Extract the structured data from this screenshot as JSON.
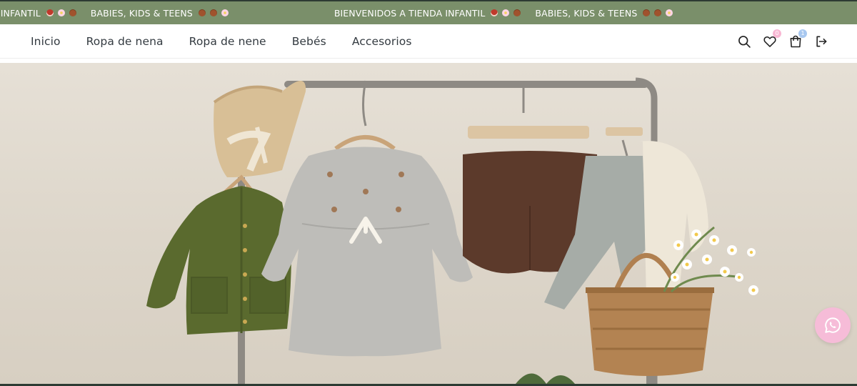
{
  "announcement": {
    "segments": [
      {
        "text": "A INFANTIL",
        "emojis": [
          "mushroom",
          "flower",
          "bear"
        ]
      },
      {
        "text": "BABIES, KIDS & TEENS",
        "emojis": [
          "bear",
          "bear",
          "flower"
        ]
      },
      {
        "text": "BIENVENIDOS A TIENDA INFANTIL",
        "emojis": [
          "mushroom",
          "flower",
          "bear"
        ]
      },
      {
        "text": "BABIES, KIDS & TEENS",
        "emojis": [
          "bear",
          "bear",
          "flower"
        ]
      }
    ],
    "background": "#7a8f6a"
  },
  "nav": {
    "items": [
      {
        "label": "Inicio"
      },
      {
        "label": "Ropa de nena"
      },
      {
        "label": "Ropa de nene"
      },
      {
        "label": "Bebés"
      },
      {
        "label": "Accesorios"
      }
    ]
  },
  "header_icons": {
    "search": "search-icon",
    "wishlist": "heart-icon",
    "wishlist_count": "0",
    "cart": "shopping-bag-icon",
    "cart_count": "1",
    "logout": "logout-icon"
  },
  "hero": {
    "image": "baby clothes on a wooden hanging rack with a straw hat, olive jacket, grey knit dress, brown bloomers, knit pants, cream cardigan and a wicker basket of daisies"
  },
  "floating": {
    "whatsapp": "whatsapp-icon",
    "color": "#f6bcd8"
  }
}
